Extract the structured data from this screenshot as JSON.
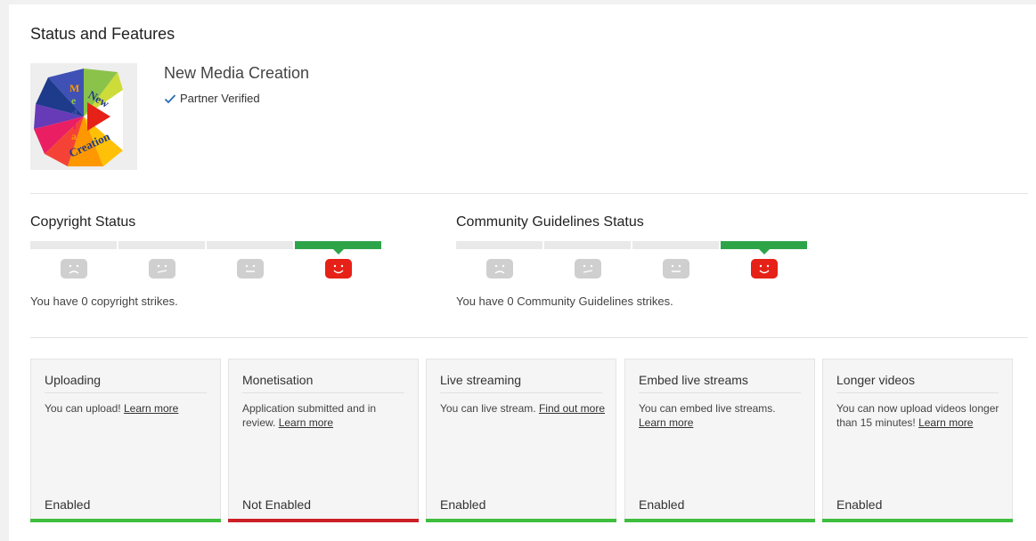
{
  "page": {
    "title": "Status and Features"
  },
  "channel": {
    "name": "New Media Creation",
    "verified_label": "Partner Verified",
    "logo_text": [
      "M",
      "e",
      "d",
      "i",
      "a",
      "New",
      "Creation"
    ]
  },
  "copyright": {
    "title": "Copyright Status",
    "message": "You have 0 copyright strikes.",
    "active_index": 3
  },
  "community": {
    "title": "Community Guidelines Status",
    "message": "You have 0 Community Guidelines strikes.",
    "active_index": 3
  },
  "features": [
    {
      "title": "Uploading",
      "desc": "You can upload! ",
      "link": "Learn more",
      "status": "Enabled",
      "enabled": true
    },
    {
      "title": "Monetisation",
      "desc": "Application submitted and in review. ",
      "link": "Learn more",
      "status": "Not Enabled",
      "enabled": false
    },
    {
      "title": "Live streaming",
      "desc": "You can live stream. ",
      "link": "Find out more",
      "status": "Enabled",
      "enabled": true
    },
    {
      "title": "Embed live streams",
      "desc": "You can embed live streams. ",
      "link": "Learn more",
      "status": "Enabled",
      "enabled": true
    },
    {
      "title": "Longer videos",
      "desc": "You can now upload videos longer than 15 minutes! ",
      "link": "Learn more",
      "status": "Enabled",
      "enabled": true
    }
  ],
  "colors": {
    "enabled": "#3dbf3d",
    "not_enabled": "#cc2027",
    "status_active": "#2ea449",
    "strike_face": "#cfcfcf",
    "good_face": "#e62117",
    "verified_check": "#2a6bb0"
  },
  "icons": {
    "verified": "checkmark-icon",
    "strike_faces": [
      "sad-face-icon",
      "worried-face-icon",
      "neutral-face-icon",
      "happy-face-icon"
    ]
  }
}
